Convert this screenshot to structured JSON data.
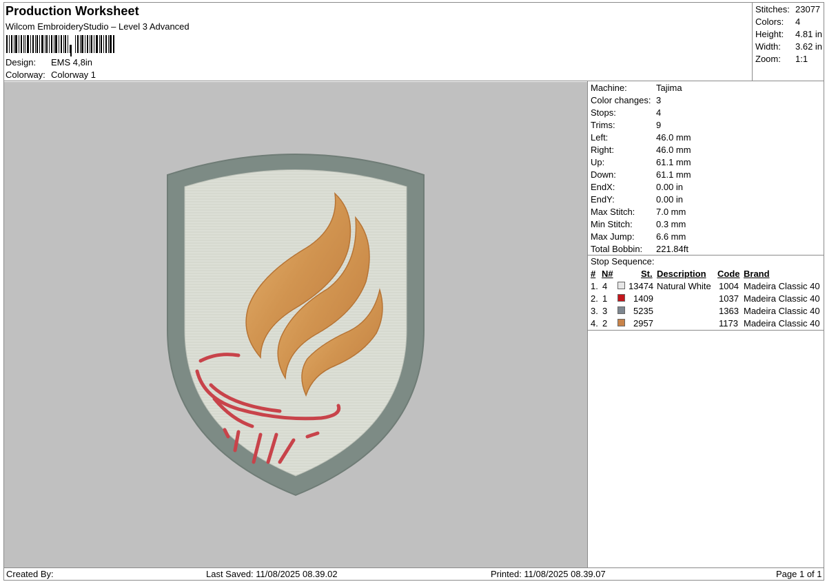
{
  "header": {
    "title": "Production Worksheet",
    "subtitle": "Wilcom EmbroideryStudio – Level 3 Advanced",
    "design_label": "Design:",
    "design_value": "EMS 4,8in",
    "colorway_label": "Colorway:",
    "colorway_value": "Colorway 1"
  },
  "stats": [
    {
      "label": "Stitches:",
      "value": "23077"
    },
    {
      "label": "Colors:",
      "value": "4"
    },
    {
      "label": "Height:",
      "value": "4.81 in"
    },
    {
      "label": "Width:",
      "value": "3.62 in"
    },
    {
      "label": "Zoom:",
      "value": "1:1"
    }
  ],
  "machine_info": [
    {
      "label": "Machine:",
      "value": "Tajima"
    },
    {
      "label": "Color changes:",
      "value": "3"
    },
    {
      "label": "Stops:",
      "value": "4"
    },
    {
      "label": "Trims:",
      "value": "9"
    },
    {
      "label": "Left:",
      "value": "46.0 mm"
    },
    {
      "label": "Right:",
      "value": "46.0 mm"
    },
    {
      "label": "Up:",
      "value": "61.1 mm"
    },
    {
      "label": "Down:",
      "value": "61.1 mm"
    },
    {
      "label": "EndX:",
      "value": "0.00 in"
    },
    {
      "label": "EndY:",
      "value": "0.00 in"
    },
    {
      "label": "Max Stitch:",
      "value": "7.0 mm"
    },
    {
      "label": "Min Stitch:",
      "value": "0.3 mm"
    },
    {
      "label": "Max Jump:",
      "value": "6.6 mm"
    },
    {
      "label": "Total Bobbin:",
      "value": "221.84ft"
    }
  ],
  "stop_sequence": {
    "title": "Stop Sequence:",
    "columns": [
      "#",
      "N#",
      "St.",
      "Description",
      "Code",
      "Brand"
    ],
    "rows": [
      {
        "num": "1.",
        "n": "4",
        "color": "#e6e6e6",
        "st": "13474",
        "desc": "Natural White",
        "code": "1004",
        "brand": "Madeira Classic 40"
      },
      {
        "num": "2.",
        "n": "1",
        "color": "#c4161c",
        "st": "1409",
        "desc": "",
        "code": "1037",
        "brand": "Madeira Classic 40"
      },
      {
        "num": "3.",
        "n": "3",
        "color": "#7e8790",
        "st": "5235",
        "desc": "",
        "code": "1363",
        "brand": "Madeira Classic 40"
      },
      {
        "num": "4.",
        "n": "2",
        "color": "#c8834a",
        "st": "2957",
        "desc": "",
        "code": "1173",
        "brand": "Madeira Classic 40"
      }
    ]
  },
  "footer": {
    "created_by": "Created By:",
    "last_saved": "Last Saved: 11/08/2025 08.39.02",
    "printed": "Printed: 11/08/2025 08.39.07",
    "page": "Page 1 of 1"
  },
  "colors": {
    "background": "#c0c0c0",
    "shield_border": "#7d8b85",
    "shield_fill": "#dcdfd6",
    "flame": "#d89e58",
    "torch": "#c8434a"
  }
}
